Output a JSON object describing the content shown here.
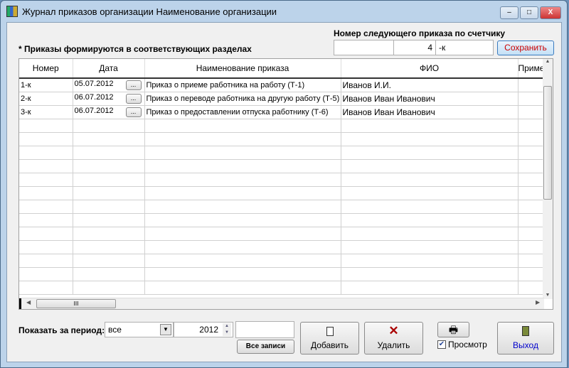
{
  "window": {
    "title": "Журнал приказов организации  Наименование организации",
    "minimize": "–",
    "maximize": "□",
    "close": "X"
  },
  "counter": {
    "label": "Номер следующего приказа по счетчику",
    "prefix": "",
    "number": "4",
    "suffix": "-к",
    "save": "Сохранить"
  },
  "note": "* Приказы формируются в соответствующих разделах",
  "table": {
    "columns": [
      "Номер",
      "Дата",
      "Наименование приказа",
      "ФИО",
      "Приме"
    ],
    "rows": [
      {
        "num": "1-к",
        "date": "05.07.2012",
        "name": "Приказ о приеме работника на работу (Т-1)",
        "fio": "Иванов И.И.",
        "note": ""
      },
      {
        "num": "2-к",
        "date": "06.07.2012",
        "name": "Приказ о переводе работника на другую работу (Т-5)",
        "fio": "Иванов Иван Иванович",
        "note": ""
      },
      {
        "num": "3-к",
        "date": "06.07.2012",
        "name": "Приказ о предоставлении отпуска работнику (Т-6)",
        "fio": "Иванов Иван Иванович",
        "note": ""
      }
    ],
    "dots": "...",
    "empty_rows": 13,
    "hscroll_thumb": "III"
  },
  "bottom": {
    "period_label": "Показать за период:",
    "period": "все",
    "year": "2012",
    "blank": "",
    "all_records": "Все записи",
    "add": "Добавить",
    "delete": "Удалить",
    "preview": "Просмотр",
    "exit": "Выход"
  },
  "colors": {
    "save_text": "#cc0000",
    "exit_text": "#0000cc",
    "delete_icon": "#aa0000"
  }
}
